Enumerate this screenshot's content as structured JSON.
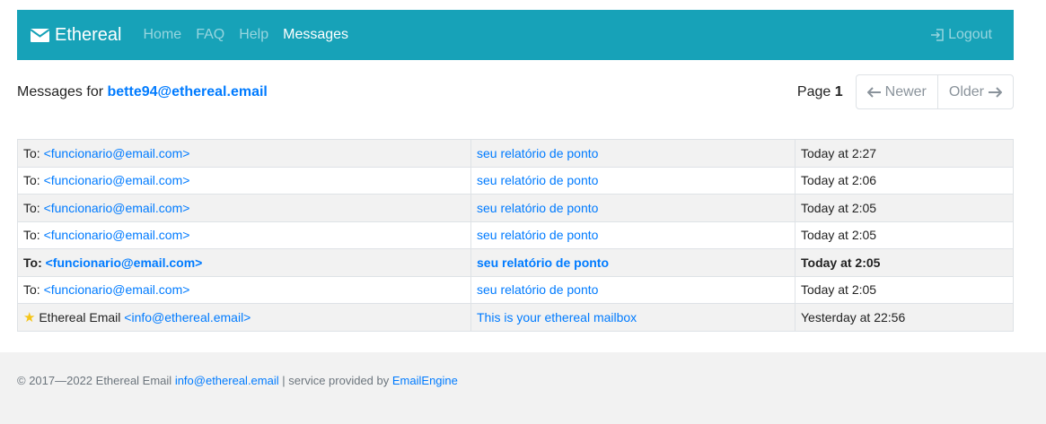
{
  "navbar": {
    "brand": "Ethereal",
    "links": [
      "Home",
      "FAQ",
      "Help",
      "Messages"
    ],
    "logout": "Logout"
  },
  "header": {
    "prefix": "Messages for",
    "address": "bette94@ethereal.email",
    "page_label": "Page",
    "page_number": "1",
    "newer": "Newer",
    "older": "Older"
  },
  "messages": [
    {
      "to_prefix": "To:",
      "to": "<funcionario@email.com>",
      "subject": "seu relatório de ponto",
      "date": "Today at 2:27"
    },
    {
      "to_prefix": "To:",
      "to": "<funcionario@email.com>",
      "subject": "seu relatório de ponto",
      "date": "Today at 2:06"
    },
    {
      "to_prefix": "To:",
      "to": "<funcionario@email.com>",
      "subject": "seu relatório de ponto",
      "date": "Today at 2:05"
    },
    {
      "to_prefix": "To:",
      "to": "<funcionario@email.com>",
      "subject": "seu relatório de ponto",
      "date": "Today at 2:05"
    },
    {
      "to_prefix": "To:",
      "to": "<funcionario@email.com>",
      "subject": "seu relatório de ponto",
      "date": "Today at 2:05"
    },
    {
      "to_prefix": "To:",
      "to": "<funcionario@email.com>",
      "subject": "seu relatório de ponto",
      "date": "Today at 2:05"
    },
    {
      "to_prefix": "Ethereal Email",
      "to": "<info@ethereal.email>",
      "subject": "This is your ethereal mailbox",
      "date": "Yesterday at 22:56"
    }
  ],
  "footer": {
    "copyright": "© 2017—2022 Ethereal Email",
    "email": "info@ethereal.email",
    "separator": "| service provided by",
    "provider": "EmailEngine"
  },
  "colors": {
    "navbar": "#17a2b8",
    "link": "#007bff",
    "star": "#f5c518"
  },
  "icons": [
    "envelope-icon",
    "logout-icon",
    "arrow-left-icon",
    "arrow-right-icon",
    "star-icon"
  ]
}
